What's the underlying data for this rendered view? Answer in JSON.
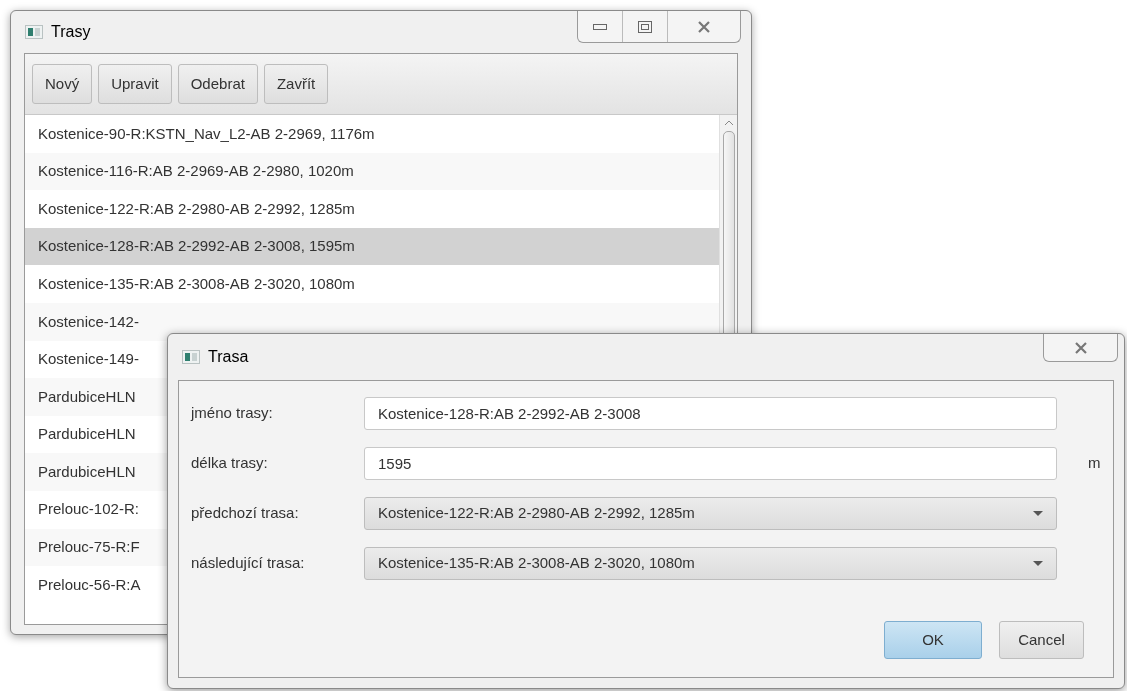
{
  "main_window": {
    "title": "Trasy",
    "toolbar": [
      "Nový",
      "Upravit",
      "Odebrat",
      "Zavřít"
    ],
    "list": [
      {
        "text": "Kostenice-90-R:KSTN_Nav_L2-AB 2-2969, 1176m",
        "selected": false
      },
      {
        "text": "Kostenice-116-R:AB 2-2969-AB 2-2980, 1020m",
        "selected": false
      },
      {
        "text": "Kostenice-122-R:AB 2-2980-AB 2-2992, 1285m",
        "selected": false
      },
      {
        "text": "Kostenice-128-R:AB 2-2992-AB 2-3008, 1595m",
        "selected": true
      },
      {
        "text": "Kostenice-135-R:AB 2-3008-AB 2-3020, 1080m",
        "selected": false
      },
      {
        "text": "Kostenice-142-",
        "selected": false
      },
      {
        "text": "Kostenice-149-",
        "selected": false
      },
      {
        "text": "PardubiceHLN",
        "selected": false
      },
      {
        "text": "PardubiceHLN",
        "selected": false
      },
      {
        "text": "PardubiceHLN",
        "selected": false
      },
      {
        "text": "Prelouc-102-R:",
        "selected": false
      },
      {
        "text": "Prelouc-75-R:F",
        "selected": false
      },
      {
        "text": "Prelouc-56-R:A",
        "selected": false
      }
    ]
  },
  "dialog": {
    "title": "Trasa",
    "fields": [
      {
        "kind": "text",
        "label": "jméno trasy:",
        "value": "Kostenice-128-R:AB 2-2992-AB 2-3008"
      },
      {
        "kind": "text",
        "label": "délka trasy:",
        "value": "1595",
        "unit": "m"
      },
      {
        "kind": "select",
        "label": "předchozí trasa:",
        "value": "Kostenice-122-R:AB 2-2980-AB 2-2992, 1285m"
      },
      {
        "kind": "select",
        "label": "následující trasa:",
        "value": "Kostenice-135-R:AB 2-3008-AB 2-3020, 1080m"
      }
    ],
    "buttons": [
      {
        "label": "OK",
        "default": true
      },
      {
        "label": "Cancel",
        "default": false
      }
    ]
  }
}
